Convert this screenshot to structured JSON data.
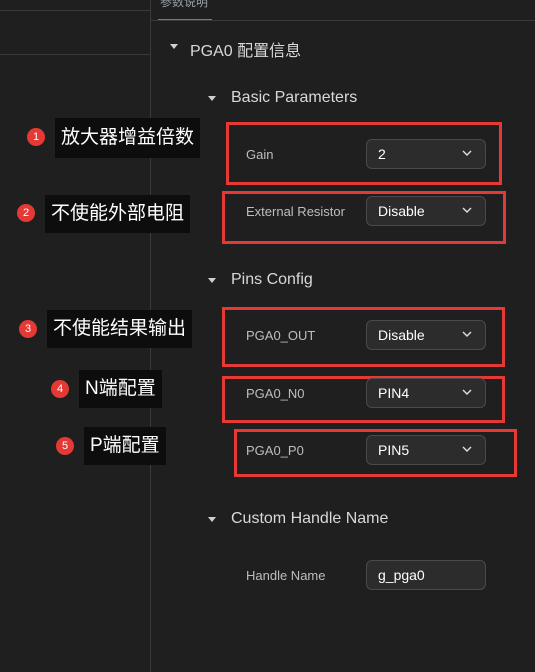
{
  "panel": {
    "tab": "参数说明"
  },
  "tree": {
    "root_title": "PGA0 配置信息"
  },
  "sections": {
    "basic": {
      "title": "Basic Parameters",
      "gain": {
        "label": "Gain",
        "value": "2"
      },
      "external_resistor": {
        "label": "External Resistor",
        "value": "Disable"
      }
    },
    "pins": {
      "title": "Pins Config",
      "out": {
        "label": "PGA0_OUT",
        "value": "Disable"
      },
      "n0": {
        "label": "PGA0_N0",
        "value": "PIN4"
      },
      "p0": {
        "label": "PGA0_P0",
        "value": "PIN5"
      }
    },
    "custom": {
      "title": "Custom Handle Name",
      "handle": {
        "label": "Handle Name",
        "value": "g_pga0"
      }
    }
  },
  "annotations": [
    {
      "num": "1",
      "text": "放大器增益倍数"
    },
    {
      "num": "2",
      "text": "不使能外部电阻"
    },
    {
      "num": "3",
      "text": "不使能结果输出"
    },
    {
      "num": "4",
      "text": "N端配置"
    },
    {
      "num": "5",
      "text": "P端配置"
    }
  ],
  "colors": {
    "accent": "#3b82f6",
    "annotation_red": "#e53935",
    "background": "#1f1f1f"
  }
}
